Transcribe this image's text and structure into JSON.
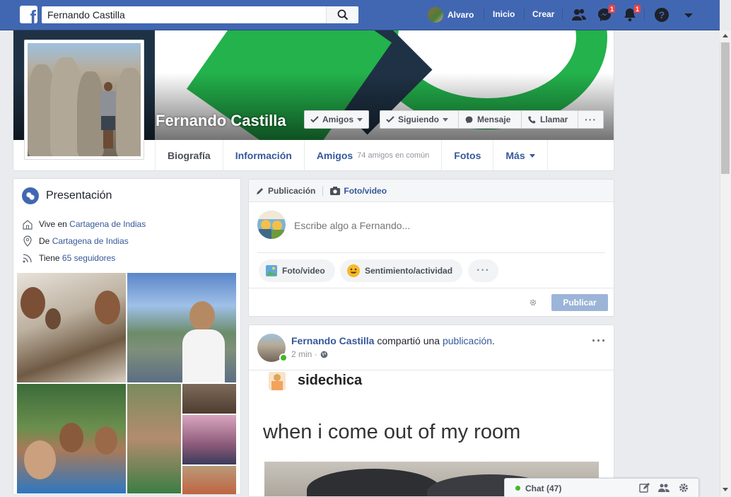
{
  "topbar": {
    "search_value": "Fernando Castilla",
    "user_name": "Alvaro",
    "home_label": "Inicio",
    "create_label": "Crear",
    "messages_badge": "1",
    "notifications_badge": "1",
    "bg_color": "#4267b2"
  },
  "profile": {
    "name": "Fernando Castilla",
    "buttons": {
      "friends": "Amigos",
      "following": "Siguiendo",
      "message": "Mensaje",
      "call": "Llamar"
    },
    "tabs": [
      {
        "label": "Biografía"
      },
      {
        "label": "Información"
      },
      {
        "label": "Amigos",
        "sub": "74 amigos en común"
      },
      {
        "label": "Fotos"
      },
      {
        "label": "Más"
      }
    ]
  },
  "intro": {
    "title": "Presentación",
    "lives_prefix": "Vive en",
    "lives_city": "Cartagena de Indias",
    "from_prefix": "De",
    "from_city": "Cartagena de Indias",
    "followers_prefix": "Tiene",
    "followers_link": "65 seguidores"
  },
  "composer": {
    "tab_post": "Publicación",
    "tab_photo": "Foto/video",
    "placeholder": "Escribe algo a Fernando...",
    "chip_photo": "Foto/video",
    "chip_feeling": "Sentimiento/actividad",
    "publish_label": "Publicar"
  },
  "post": {
    "author": "Fernando Castilla",
    "action": "compartió una",
    "object": "publicación",
    "time": "2 min ·",
    "meme_user": "sidechica",
    "meme_caption": "when i come out of my room"
  },
  "chat": {
    "label": "Chat (47)"
  }
}
